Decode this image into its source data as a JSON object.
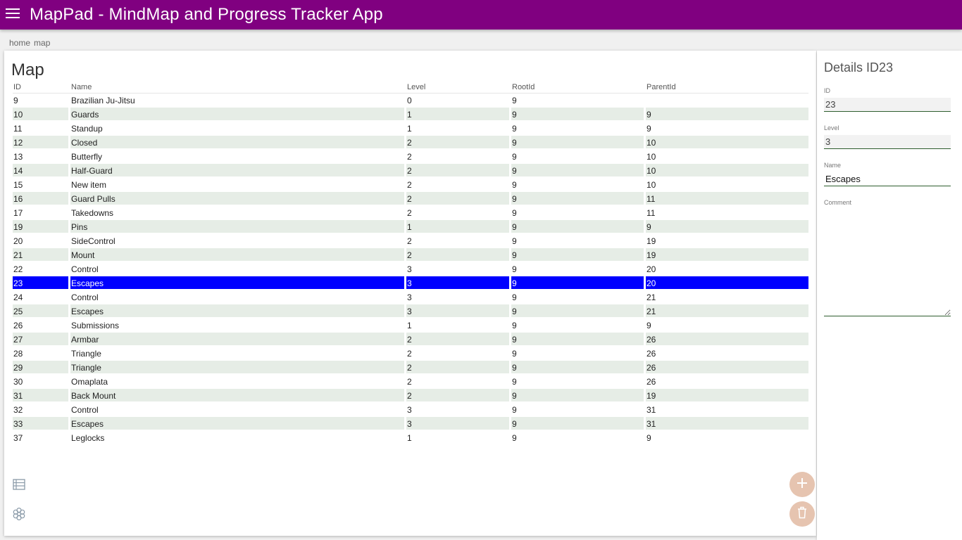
{
  "app": {
    "title": "MapPad - MindMap and Progress Tracker App",
    "bar_color": "#800080"
  },
  "breadcrumb": [
    "home",
    "map"
  ],
  "map": {
    "title": "Map",
    "columns": [
      "ID",
      "Name",
      "Level",
      "RootId",
      "ParentId"
    ],
    "selected_id": "23",
    "rows": [
      [
        "9",
        "Brazilian Ju-Jitsu",
        "0",
        "9",
        ""
      ],
      [
        "10",
        "Guards",
        "1",
        "9",
        "9"
      ],
      [
        "11",
        "Standup",
        "1",
        "9",
        "9"
      ],
      [
        "12",
        "Closed",
        "2",
        "9",
        "10"
      ],
      [
        "13",
        "Butterfly",
        "2",
        "9",
        "10"
      ],
      [
        "14",
        "Half-Guard",
        "2",
        "9",
        "10"
      ],
      [
        "15",
        "New item",
        "2",
        "9",
        "10"
      ],
      [
        "16",
        "Guard Pulls",
        "2",
        "9",
        "11"
      ],
      [
        "17",
        "Takedowns",
        "2",
        "9",
        "11"
      ],
      [
        "19",
        "Pins",
        "1",
        "9",
        "9"
      ],
      [
        "20",
        "SideControl",
        "2",
        "9",
        "19"
      ],
      [
        "21",
        "Mount",
        "2",
        "9",
        "19"
      ],
      [
        "22",
        "Control",
        "3",
        "9",
        "20"
      ],
      [
        "23",
        "Escapes",
        "3",
        "9",
        "20"
      ],
      [
        "24",
        "Control",
        "3",
        "9",
        "21"
      ],
      [
        "25",
        "Escapes",
        "3",
        "9",
        "21"
      ],
      [
        "26",
        "Submissions",
        "1",
        "9",
        "9"
      ],
      [
        "27",
        "Armbar",
        "2",
        "9",
        "26"
      ],
      [
        "28",
        "Triangle",
        "2",
        "9",
        "26"
      ],
      [
        "29",
        "Triangle",
        "2",
        "9",
        "26"
      ],
      [
        "30",
        "Omaplata",
        "2",
        "9",
        "26"
      ],
      [
        "31",
        "Back Mount",
        "2",
        "9",
        "19"
      ],
      [
        "32",
        "Control",
        "3",
        "9",
        "31"
      ],
      [
        "33",
        "Escapes",
        "3",
        "9",
        "31"
      ],
      [
        "37",
        "Leglocks",
        "1",
        "9",
        "9"
      ]
    ],
    "stripe_color": "#e6ede6",
    "selected_color": "#0000ff"
  },
  "icons": {
    "menu": "menu-icon",
    "list": "list-icon",
    "mindmap": "flower-icon",
    "add": "plus-icon",
    "delete": "trash-icon"
  },
  "details": {
    "title": "Details ID23",
    "id_label": "ID",
    "id_value": "23",
    "level_label": "Level",
    "level_value": "3",
    "name_label": "Name",
    "name_value": "Escapes",
    "comment_label": "Comment",
    "comment_value": ""
  }
}
